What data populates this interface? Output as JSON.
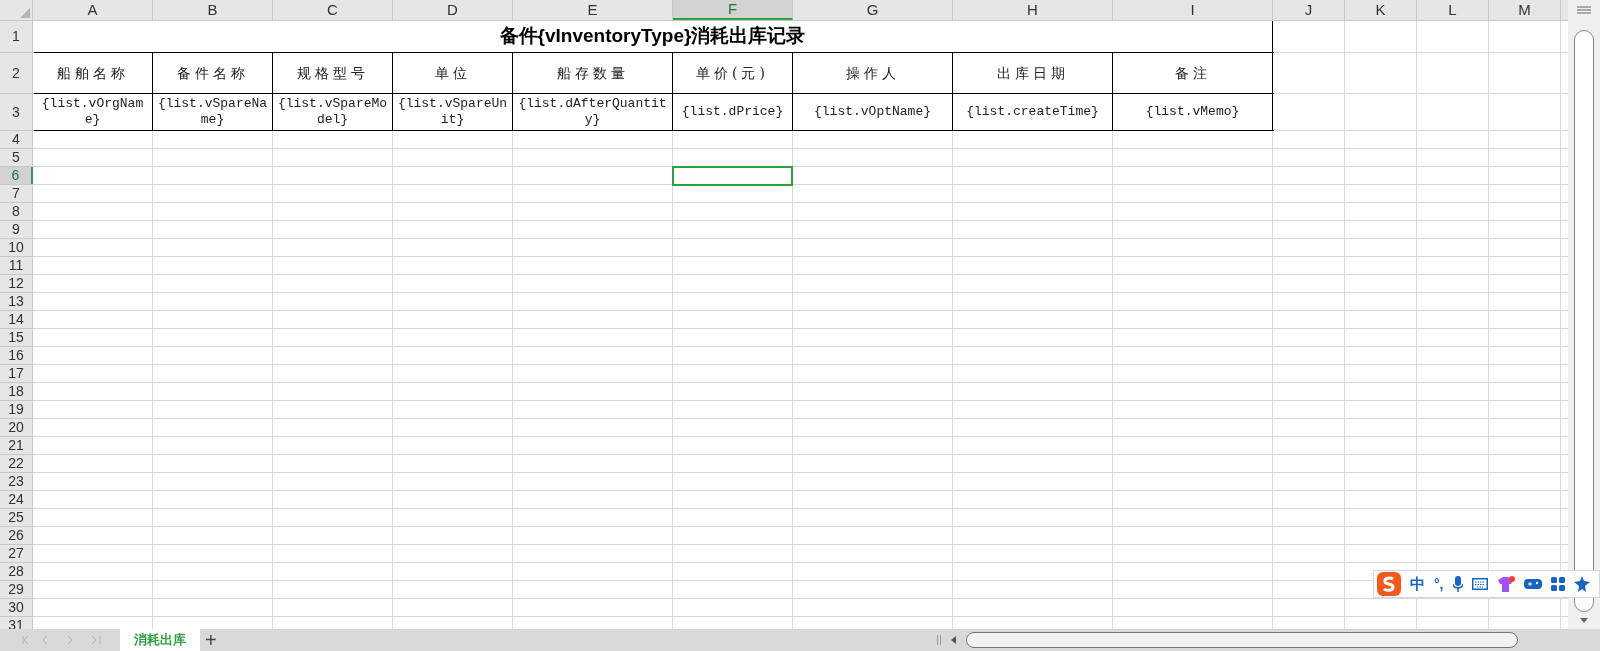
{
  "columns": [
    {
      "label": "A",
      "selected": false
    },
    {
      "label": "B",
      "selected": false
    },
    {
      "label": "C",
      "selected": false
    },
    {
      "label": "D",
      "selected": false
    },
    {
      "label": "E",
      "selected": false
    },
    {
      "label": "F",
      "selected": true
    },
    {
      "label": "G",
      "selected": false
    },
    {
      "label": "H",
      "selected": false
    },
    {
      "label": "I",
      "selected": false
    },
    {
      "label": "J",
      "selected": false
    },
    {
      "label": "K",
      "selected": false
    },
    {
      "label": "L",
      "selected": false
    },
    {
      "label": "M",
      "selected": false
    }
  ],
  "rows": [
    {
      "label": "1",
      "selected": false
    },
    {
      "label": "2",
      "selected": false
    },
    {
      "label": "3",
      "selected": false
    },
    {
      "label": "4",
      "selected": false
    },
    {
      "label": "5",
      "selected": false
    },
    {
      "label": "6",
      "selected": true
    },
    {
      "label": "7",
      "selected": false
    },
    {
      "label": "8",
      "selected": false
    },
    {
      "label": "9",
      "selected": false
    },
    {
      "label": "10",
      "selected": false
    },
    {
      "label": "11",
      "selected": false
    },
    {
      "label": "12",
      "selected": false
    },
    {
      "label": "13",
      "selected": false
    },
    {
      "label": "14",
      "selected": false
    },
    {
      "label": "15",
      "selected": false
    },
    {
      "label": "16",
      "selected": false
    },
    {
      "label": "17",
      "selected": false
    },
    {
      "label": "18",
      "selected": false
    },
    {
      "label": "19",
      "selected": false
    },
    {
      "label": "20",
      "selected": false
    },
    {
      "label": "21",
      "selected": false
    },
    {
      "label": "22",
      "selected": false
    },
    {
      "label": "23",
      "selected": false
    },
    {
      "label": "24",
      "selected": false
    },
    {
      "label": "25",
      "selected": false
    },
    {
      "label": "26",
      "selected": false
    },
    {
      "label": "27",
      "selected": false
    },
    {
      "label": "28",
      "selected": false
    },
    {
      "label": "29",
      "selected": false
    },
    {
      "label": "30",
      "selected": false
    },
    {
      "label": "31",
      "selected": false
    }
  ],
  "title": "备件{vInventoryType}消耗出库记录",
  "header_cells": [
    "船舶名称",
    "备件名称",
    "规格型号",
    "单位",
    "船存数量",
    "单价(元)",
    "操作人",
    "出库日期",
    "备注"
  ],
  "template_cells": [
    "{list.vOrgName}",
    "{list.vSpareName}",
    "{list.vSpareModel}",
    "{list.vSpareUnit}",
    "{list.dAfterQuantity}",
    "{list.dPrice}",
    "{list.vOptName}",
    "{list.createTime}",
    "{list.vMemo}"
  ],
  "sheet_tabs": [
    {
      "label": "消耗出库",
      "selected": true
    }
  ],
  "add_sheet": "+",
  "ime_toolbar": {
    "language": "中",
    "punctuation": "°,"
  }
}
